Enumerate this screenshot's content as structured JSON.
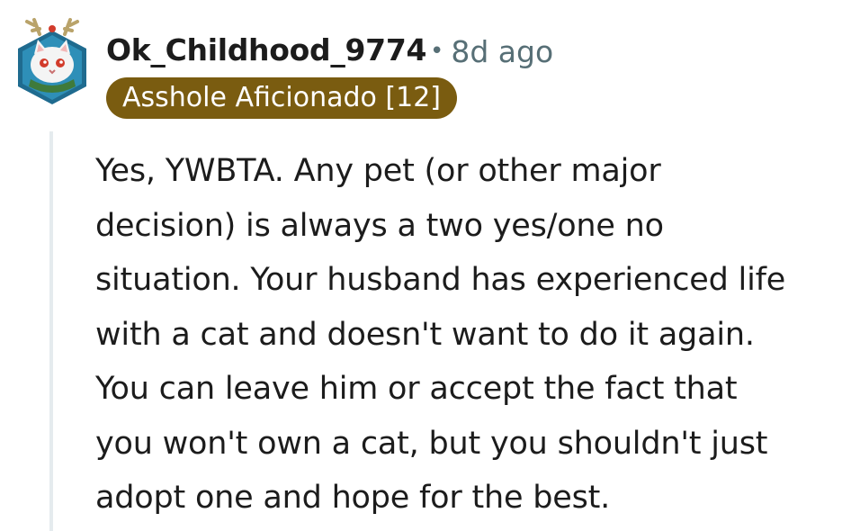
{
  "comment": {
    "username": "Ok_Childhood_9774",
    "separator": "•",
    "timestamp": "8d ago",
    "flair": "Asshole Aficionado [12]",
    "body": "Yes, YWBTA. Any pet (or other major\ndecision) is always a two yes/one no\nsituation. Your husband has experienced life\nwith a cat and doesn't want to do it again.\nYou can leave him or accept the fact that\nyou won't own a cat, but you shouldn't just\nadopt one and hope for the best.",
    "avatar": {
      "icon": "snow-cat-avatar-icon",
      "colors": {
        "frame": "#2e8fb8",
        "frame_dark": "#1f6b8f",
        "cat": "#f4f4f4",
        "eye": "#d23b2b",
        "scarf": "#3f7a3a",
        "antler": "#b9a36a"
      }
    }
  },
  "colors": {
    "flair_bg": "#7a5c10",
    "meta_text": "#576f76",
    "thread_line": "#e5ebee"
  }
}
